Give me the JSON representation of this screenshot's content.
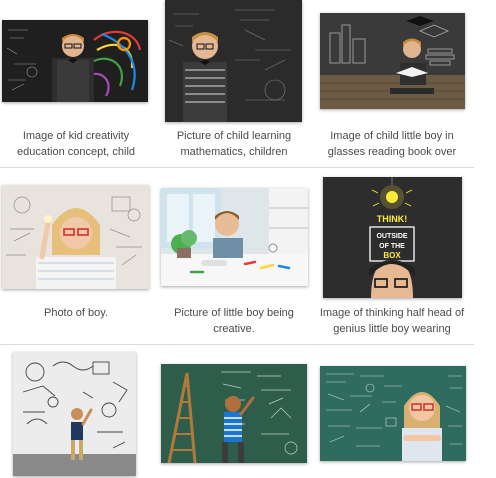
{
  "results": [
    {
      "caption_line1": "Image of kid creativity",
      "caption_line2": "education concept, child",
      "image": "kid-creativity-chalkboard"
    },
    {
      "caption_line1": "Picture of child learning",
      "caption_line2": "mathematics, children",
      "image": "child-math-chalkboard"
    },
    {
      "caption_line1": "Image of child little boy in",
      "caption_line2": "glasses reading book over",
      "image": "boy-reading-book"
    },
    {
      "caption_line1": "Photo of boy.",
      "caption_line2": "",
      "image": "girl-glasses-sketches"
    },
    {
      "caption_line1": "Picture of little boy being",
      "caption_line2": "creative.",
      "image": "boy-crafting-table"
    },
    {
      "caption_line1": "Image of thinking half head of",
      "caption_line2": "genius little boy wearing",
      "image": "think-outside-the-box"
    },
    {
      "caption_line1": "",
      "caption_line2": "",
      "image": "boy-drawing-wall"
    },
    {
      "caption_line1": "",
      "caption_line2": "",
      "image": "boy-ladder-chalkboard"
    },
    {
      "caption_line1": "",
      "caption_line2": "",
      "image": "girl-formulas-board"
    }
  ],
  "think_sign": {
    "line1": "THINK!",
    "line2": "OUTSIDE",
    "line3": "OF THE",
    "line4": "BOX"
  }
}
